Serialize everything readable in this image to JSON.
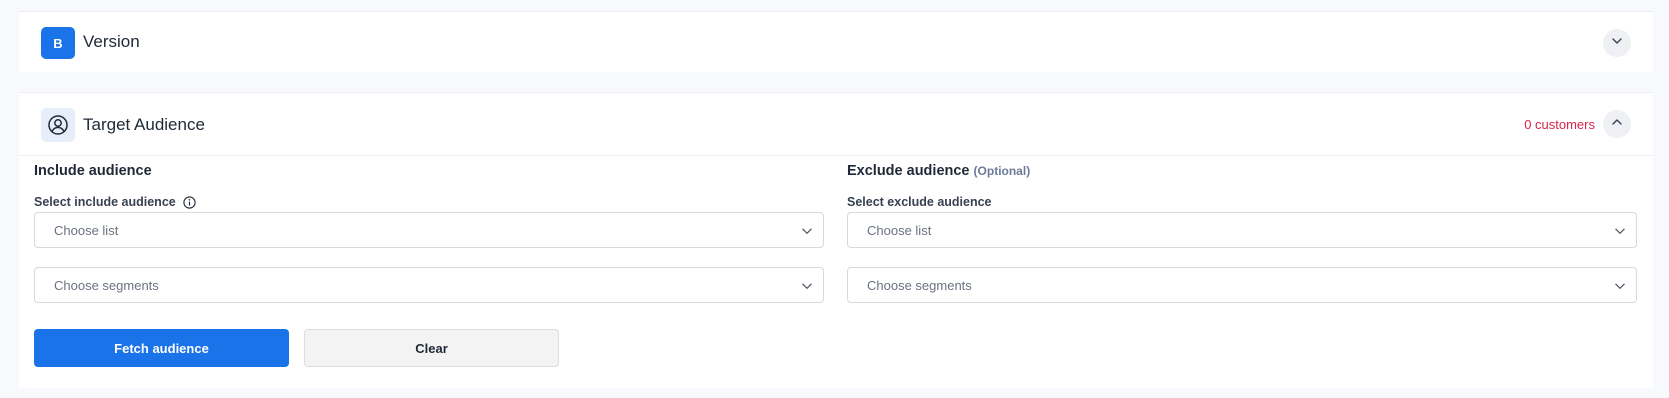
{
  "version_section": {
    "badge": "B",
    "title": "Version",
    "toggle_icon": "chevron-down-icon"
  },
  "audience_section": {
    "icon": "user-circle-icon",
    "title": "Target Audience",
    "customers": "0 customers",
    "toggle_icon": "chevron-up-icon",
    "include": {
      "title": "Include audience",
      "label": "Select include audience",
      "list_placeholder": "Choose list",
      "segments_placeholder": "Choose segments"
    },
    "exclude": {
      "title": "Exclude audience",
      "optional": "(Optional)",
      "label": "Select exclude audience",
      "list_placeholder": "Choose list",
      "segments_placeholder": "Choose segments"
    },
    "fetch_label": "Fetch audience",
    "clear_label": "Clear"
  },
  "colors": {
    "primary": "#1a73e8",
    "customers": "#d6254b",
    "optional": "#6b7a99"
  }
}
